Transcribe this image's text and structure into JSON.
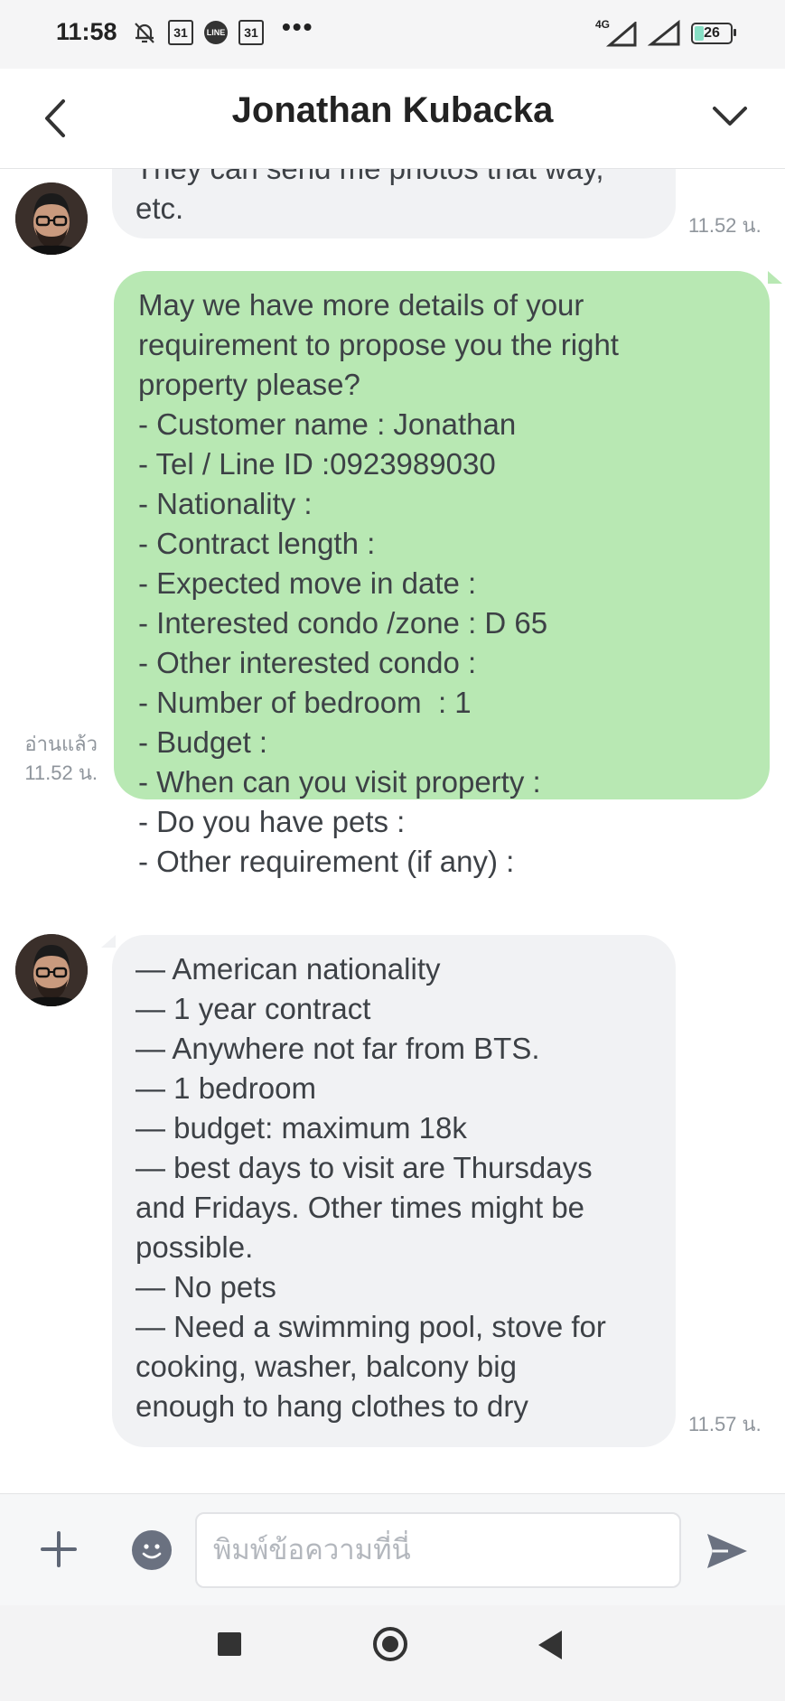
{
  "status_bar": {
    "time": "11:58",
    "calendar_day_1": "31",
    "calendar_day_2": "31",
    "line_badge": "LINE",
    "more": "•••",
    "network": "4G",
    "battery": "26",
    "battery_level_percent": 26
  },
  "header": {
    "title": "Jonathan Kubacka",
    "back_icon": "chevron-left-icon",
    "menu_icon": "chevron-down-icon"
  },
  "messages": [
    {
      "sender": "contact",
      "text": "They can send me photos that way,\netc.",
      "time": "11.52 น."
    },
    {
      "sender": "me",
      "text": "May we have more details of your\nrequirement to propose you the right\nproperty please?\n- Customer name : Jonathan\n- Tel / Line ID :0923989030\n- Nationality :\n- Contract length :\n- Expected move in date :\n- Interested condo /zone : D 65\n- Other interested condo :\n- Number of bedroom  : 1\n- Budget :\n- When can you visit property :\n- Do you have pets :\n- Other requirement (if any) :",
      "read_status": "อ่านแล้ว",
      "time": "11.52 น."
    },
    {
      "sender": "contact",
      "text": "— American nationality\n— 1 year contract\n— Anywhere not far from BTS.\n— 1 bedroom\n— budget: maximum 18k\n— best days to visit are Thursdays\nand Fridays. Other times might be\npossible.\n— No pets\n— Need a swimming pool, stove for\ncooking, washer, balcony big\nenough to hang clothes to dry",
      "time": "11.57 น."
    }
  ],
  "input_bar": {
    "placeholder": "พิมพ์ข้อความที่นี่",
    "value": "",
    "add_icon": "plus-icon",
    "emoji_icon": "smiley-icon",
    "send_icon": "send-icon"
  },
  "nav_bar": {
    "recents_icon": "square-icon",
    "home_icon": "circle-icon",
    "back_icon": "triangle-back-icon"
  },
  "colors": {
    "outgoing_bubble": "#b8e8b3",
    "incoming_bubble": "#f1f2f4",
    "timestamp": "#8f959c"
  }
}
